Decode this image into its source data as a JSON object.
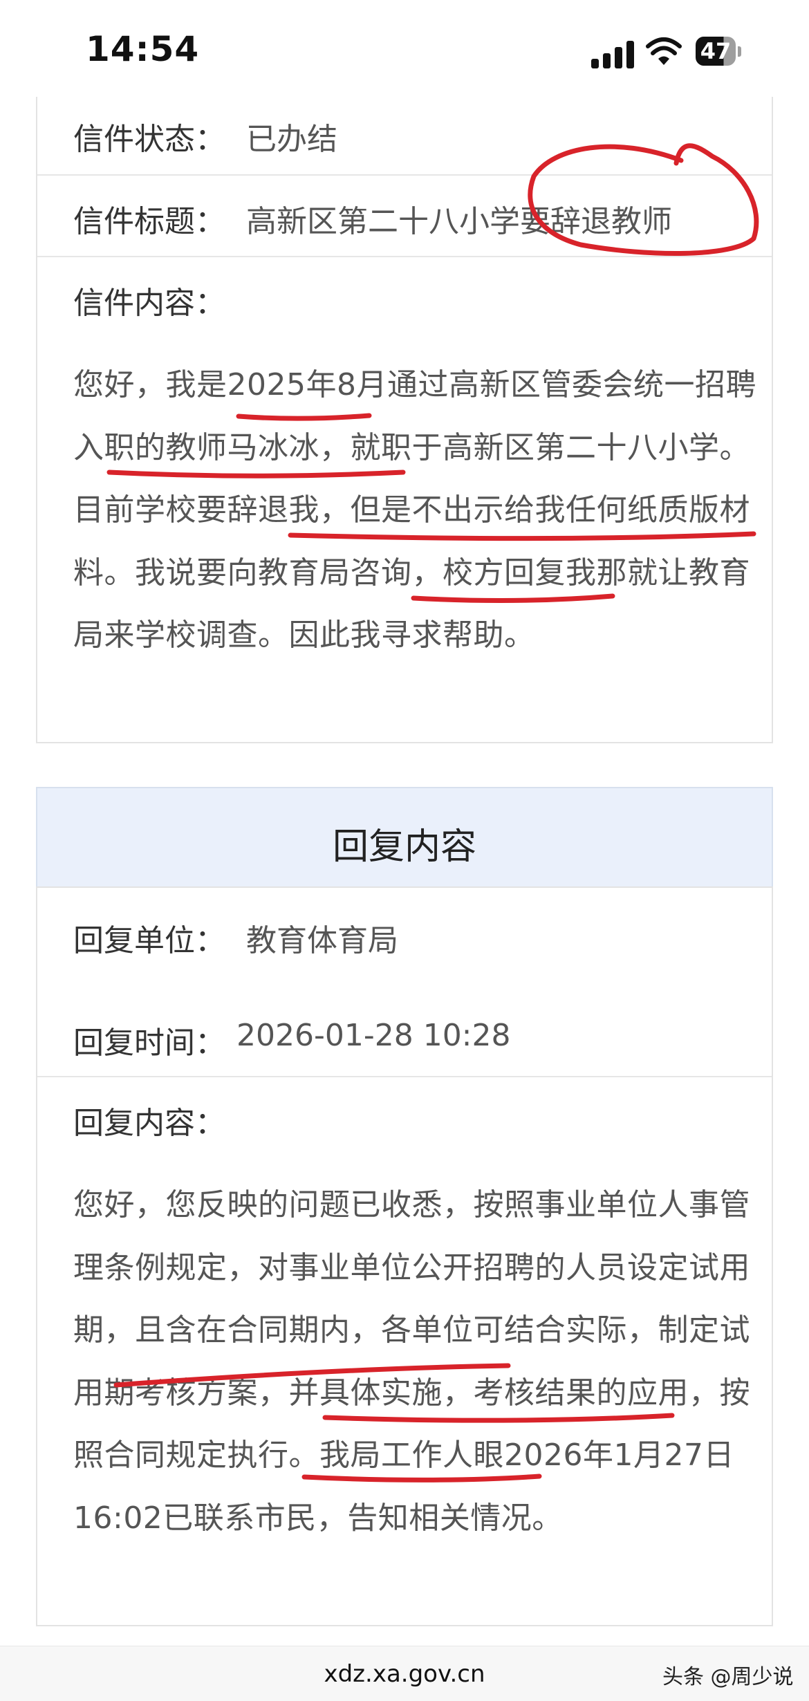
{
  "status_bar": {
    "time": "14:54",
    "battery": "47"
  },
  "letter": {
    "status_label": "信件状态：",
    "status_value": "已办结",
    "title_label": "信件标题：",
    "title_value": "高新区第二十八小学要辞退教师",
    "content_label": "信件内容：",
    "content_text": "您好，我是2025年8月通过高新区管委会统一招聘入职的教师马冰冰，就职于高新区第二十八小学。目前学校要辞退我，但是不出示给我任何纸质版材料。我说要向教育局咨询，校方回复我那就让教育局来学校调查。因此我寻求帮助。"
  },
  "reply": {
    "header": "回复内容",
    "unit_label": "回复单位：",
    "unit_value": "教育体育局",
    "time_label": "回复时间：",
    "time_value": "2026-01-28 10:28",
    "content_label": "回复内容：",
    "content_text": "您好，您反映的问题已收悉，按照事业单位人事管理条例规定，对事业单位公开招聘的人员设定试用期，且含在合同期内，各单位可结合实际，制定试用期考核方案，并具体实施，考核结果的应用，按照合同规定执行。我局工作人眼2026年1月27日16:02已联系市民，告知相关情况。"
  },
  "footer": {
    "url": "xdz.xa.gov.cn",
    "watermark": "头条 @周少说"
  },
  "colors": {
    "annotation_red": "#d8232a",
    "reply_header_bg": "#eaf0fb"
  }
}
